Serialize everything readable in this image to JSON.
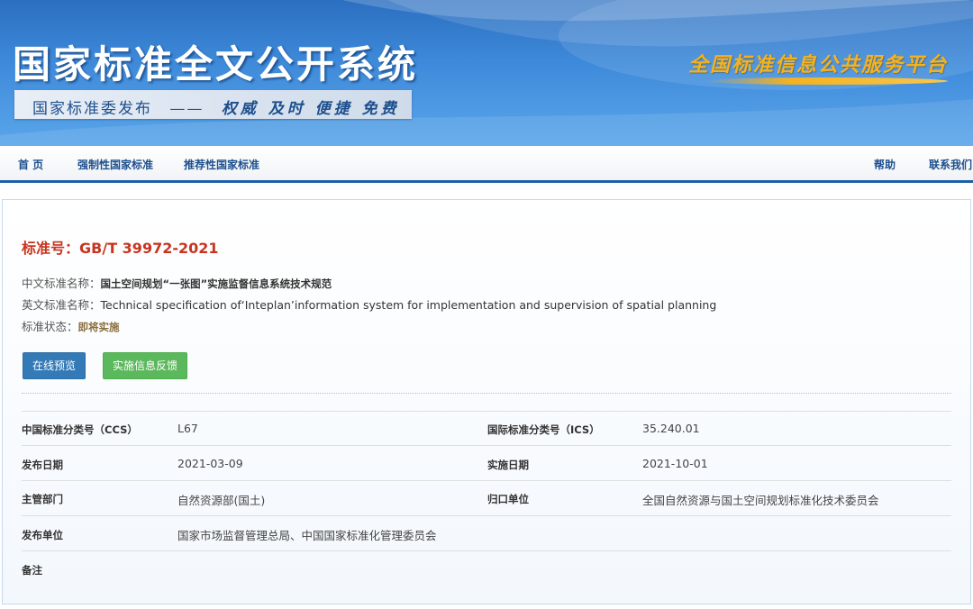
{
  "banner": {
    "title": "国家标准全文公开系统",
    "subtitle_left": "国家标准委发布",
    "subtitle_dash": "——",
    "subtitle_motto": "权威 及时 便捷 免费",
    "platform_name": "全国标准信息公共服务平台"
  },
  "nav": {
    "items": [
      "首 页",
      "强制性国家标准",
      "推荐性国家标准"
    ],
    "right_items": [
      "帮助",
      "联系我们"
    ]
  },
  "standard": {
    "number_label": "标准号：",
    "number": "GB/T 39972-2021",
    "cn_name_label": "中文标准名称：",
    "cn_name": "国土空间规划“一张图”实施监督信息系统技术规范",
    "en_name_label": "英文标准名称：",
    "en_name": "Technical specification of‘Inteplan’information system for implementation and supervision of spatial planning",
    "status_label": "标准状态：",
    "status": "即将实施"
  },
  "buttons": {
    "preview": "在线预览",
    "feedback": "实施信息反馈"
  },
  "details": {
    "ccs_label": "中国标准分类号（CCS）",
    "ccs": "L67",
    "ics_label": "国际标准分类号（ICS）",
    "ics": "35.240.01",
    "publish_date_label": "发布日期",
    "publish_date": "2021-03-09",
    "impl_date_label": "实施日期",
    "impl_date": "2021-10-01",
    "dept_label": "主管部门",
    "dept": "自然资源部(国土)",
    "owner_label": "归口单位",
    "owner": "全国自然资源与国土空间规划标准化技术委员会",
    "publisher_label": "发布单位",
    "publisher": "国家市场监督管理总局、中国国家标准化管理委员会",
    "remark_label": "备注"
  },
  "colors": {
    "banner_blue": "#3f8bdb",
    "nav_accent": "#1f5fa9",
    "standard_number_red": "#c8341f",
    "preview_button": "#337ab7",
    "feedback_button": "#5cb85c",
    "platform_gold": "#f5b21d"
  }
}
